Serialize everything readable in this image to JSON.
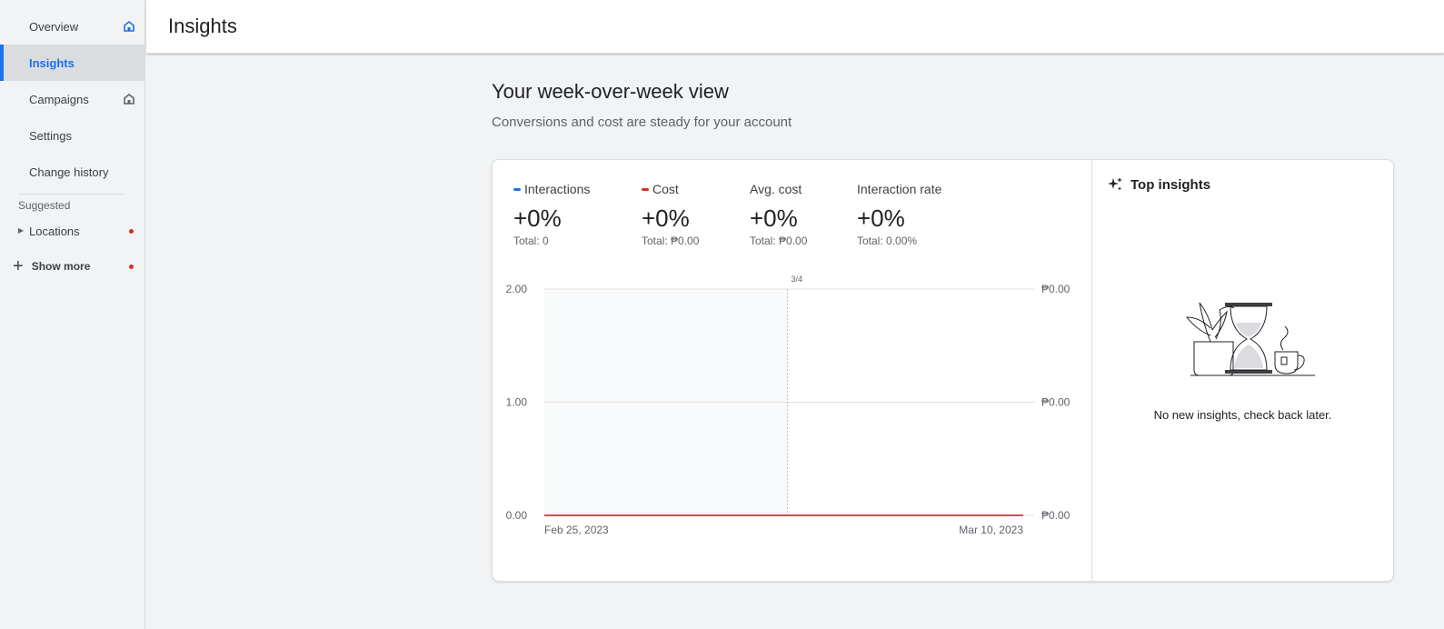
{
  "sidebar": {
    "items": [
      {
        "label": "Overview",
        "icon": "home-icon"
      },
      {
        "label": "Insights"
      },
      {
        "label": "Campaigns",
        "icon": "home-icon"
      },
      {
        "label": "Settings"
      },
      {
        "label": "Change history"
      }
    ],
    "suggested_label": "Suggested",
    "locations_label": "Locations",
    "show_more_label": "Show more"
  },
  "header": {
    "title": "Insights"
  },
  "main": {
    "heading": "Your week-over-week view",
    "subheading": "Conversions and cost are steady for your account"
  },
  "metrics": [
    {
      "label": "Interactions",
      "value": "+0%",
      "total": "Total: 0",
      "color": "#1a73e8"
    },
    {
      "label": "Cost",
      "value": "+0%",
      "total": "Total: ₱0.00",
      "color": "#d93025"
    },
    {
      "label": "Avg. cost",
      "value": "+0%",
      "total": "Total: ₱0.00"
    },
    {
      "label": "Interaction rate",
      "value": "+0%",
      "total": "Total: 0.00%"
    }
  ],
  "chart_data": {
    "type": "line",
    "x": [
      "Feb 25, 2023",
      "Mar 10, 2023"
    ],
    "x_tick_labels": [
      "Feb 25, 2023",
      "Mar 10, 2023"
    ],
    "marker_label": "3/4",
    "y_left_ticks": [
      "2.00",
      "1.00",
      "0.00"
    ],
    "y_right_ticks": [
      "₱0.00",
      "₱0.00",
      "₱0.00"
    ],
    "ylim": [
      0,
      2
    ],
    "series": [
      {
        "name": "Interactions",
        "values": [
          0,
          0
        ],
        "color": "#1a73e8"
      },
      {
        "name": "Cost",
        "values": [
          0,
          0
        ],
        "color": "#d93025"
      }
    ],
    "grid": true
  },
  "insights": {
    "title": "Top insights",
    "empty_message": "No new insights, check back later."
  }
}
